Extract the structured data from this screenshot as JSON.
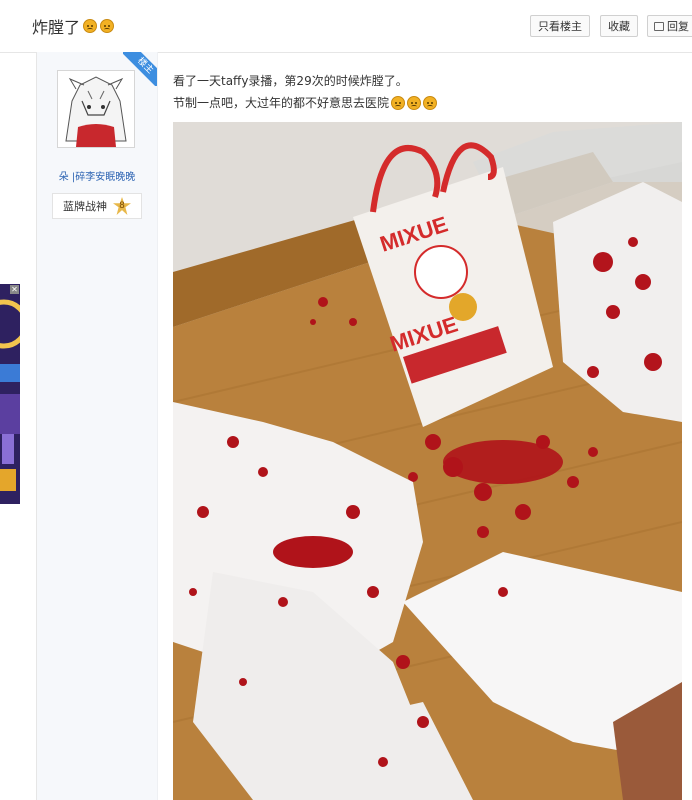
{
  "thread": {
    "title": "炸膛了",
    "title_emojis": [
      "sad-face-icon",
      "sad-face-icon"
    ]
  },
  "actions": {
    "only_lz": "只看楼主",
    "favorite": "收藏",
    "reply": "回复"
  },
  "author": {
    "lz_badge": "楼主",
    "name": "朵 |碎李安眠晚晚",
    "title_badge": "蓝牌战神",
    "level": "8"
  },
  "post": {
    "line1": "看了一天taffy录播，第29次的时候炸膛了。",
    "line2": "节制一点吧，大过年的都不好意思去医院"
  },
  "colors": {
    "accent_blue": "#3d8ee0",
    "link_blue": "#2d64b3",
    "blood_red": "#b0131a",
    "floor_wood": "#b9813d"
  }
}
